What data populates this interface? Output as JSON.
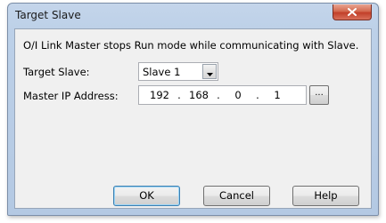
{
  "dialog": {
    "title": "Target Slave",
    "message": "O/I Link Master stops Run mode while communicating with Slave.",
    "target_slave": {
      "label": "Target Slave:",
      "selected": "Slave 1"
    },
    "master_ip": {
      "label": "Master IP Address:",
      "octets": [
        "192",
        "168",
        "0",
        "1"
      ],
      "separator": ".",
      "browse_label": "..."
    },
    "buttons": {
      "ok": "OK",
      "cancel": "Cancel",
      "help": "Help"
    }
  },
  "icons": {
    "close": "close-icon",
    "dropdown": "chevron-down-icon"
  },
  "colors": {
    "title_bar": "#bcd0e8",
    "close_button": "#c2402a",
    "client_bg": "#f0f0f0"
  }
}
